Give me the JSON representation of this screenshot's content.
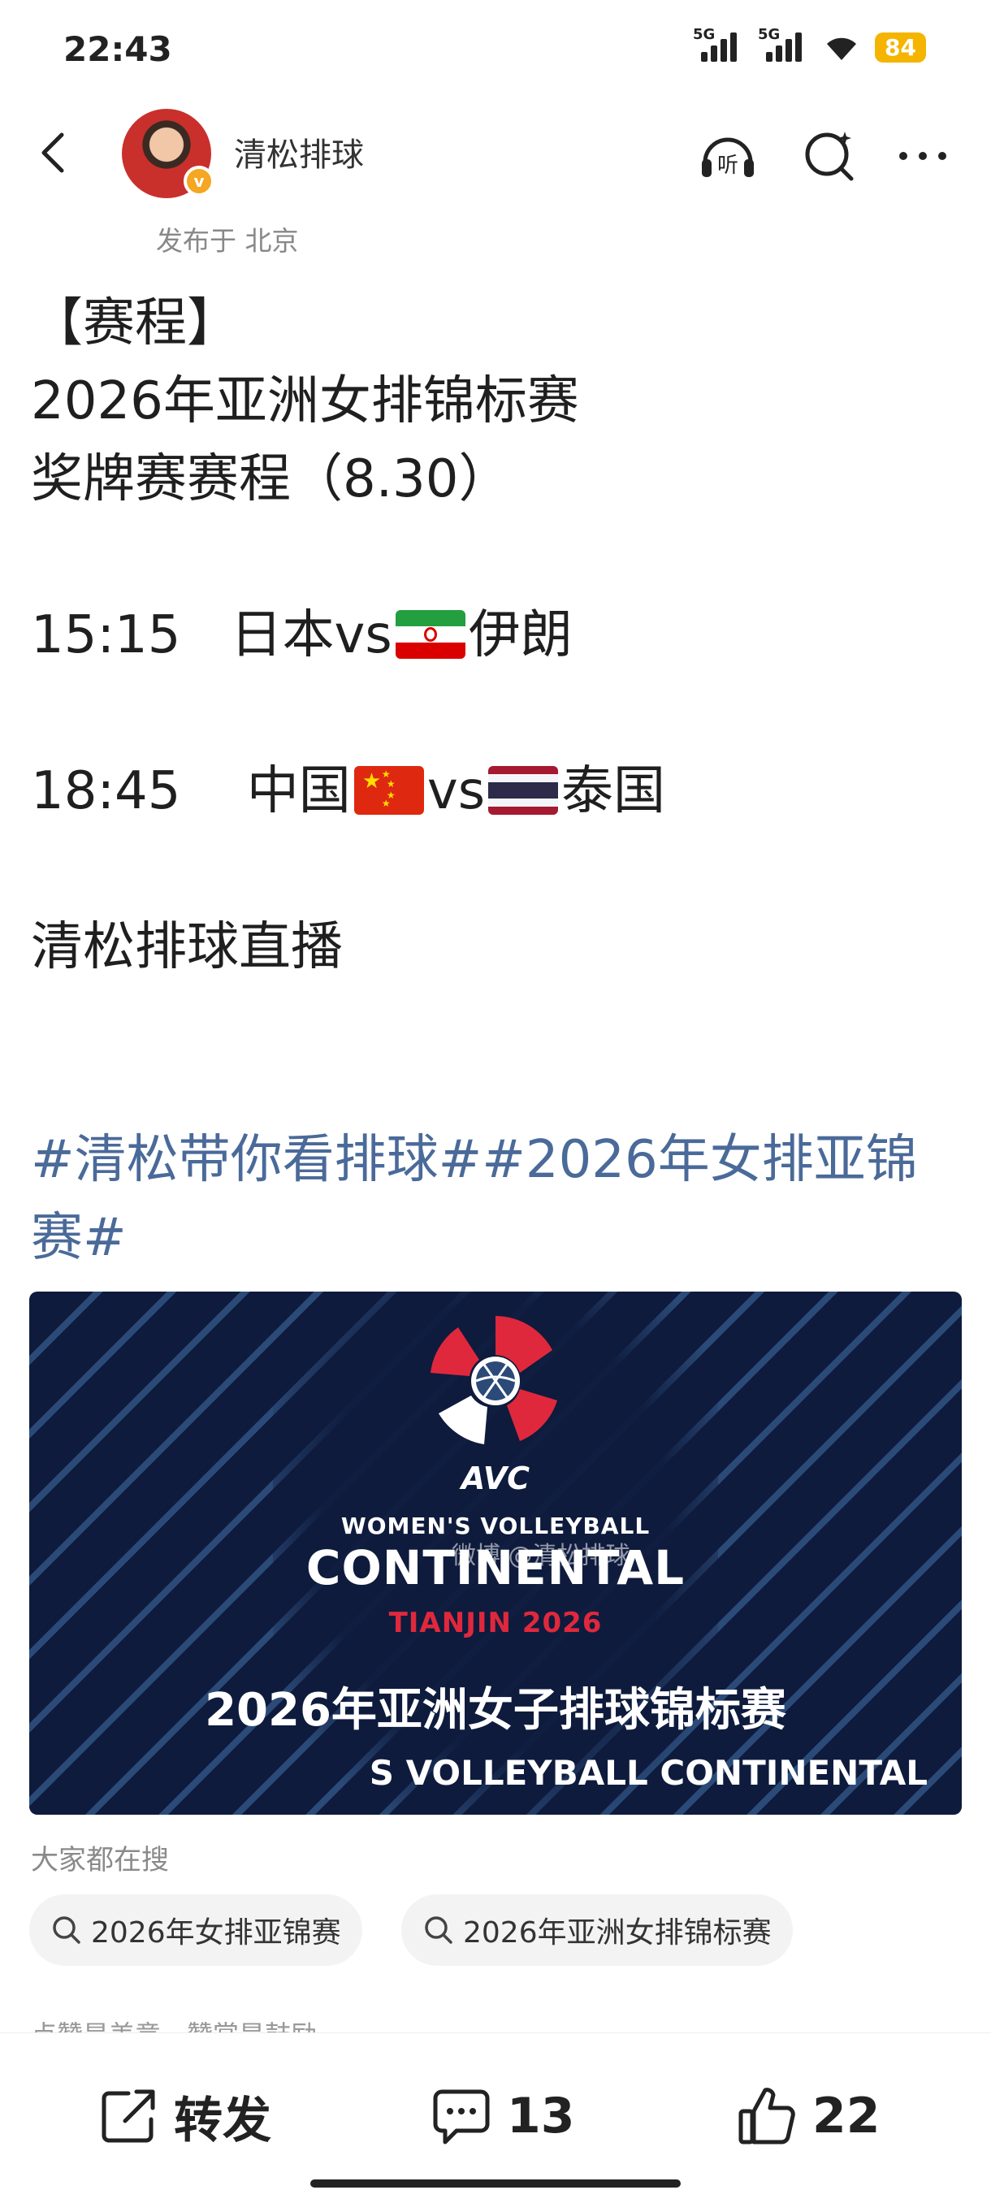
{
  "status_bar": {
    "time": "22:43",
    "sim1": "5G",
    "sim2": "5G",
    "battery": "84"
  },
  "nav": {
    "author": "清松排球",
    "location": "发布于 北京",
    "listen_icon_text": "听"
  },
  "post": {
    "lines": [
      "【赛程】",
      "2026年亚洲女排锦标赛",
      "奖牌赛赛程（8.30）"
    ],
    "match1": {
      "time": "15:15",
      "home": "日本",
      "vs": "vs",
      "away": "伊朗"
    },
    "match2": {
      "time": "18:45",
      "home": "中国",
      "vs": "vs",
      "away": "泰国"
    },
    "live_line": "清松排球直播",
    "hashtags": "#清松带你看排球##2026年女排亚锦赛#"
  },
  "banner": {
    "avc": "AVC",
    "subtitle": "WOMEN'S VOLLEYBALL",
    "title": "CONTINENTAL",
    "city": "TIANJIN 2026",
    "cn_title": "2026年亚洲女子排球锦标赛",
    "en_sub": "S VOLLEYBALL CONTINENTAL",
    "watermark": "微博 @清松排球"
  },
  "search": {
    "title": "大家都在搜",
    "chips": [
      "2026年女排亚锦赛",
      "2026年亚洲女排锦标赛"
    ]
  },
  "partial_text": "点赞是美意，赞赏是鼓励",
  "actions": {
    "repost_label": "转发",
    "comments": "13",
    "likes": "22"
  },
  "colors": {
    "hashtag": "#4a6a99",
    "banner_bg": "#0e1b3d",
    "banner_red": "#e0283c",
    "battery": "#f5b400"
  }
}
